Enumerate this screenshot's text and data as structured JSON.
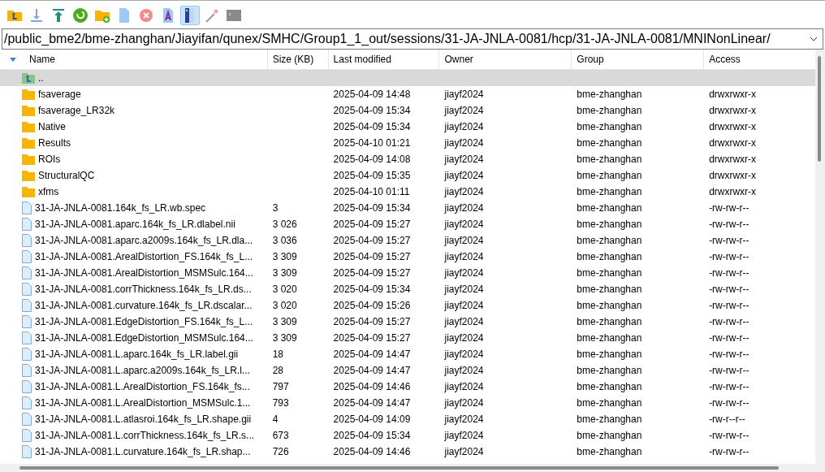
{
  "toolbar": [
    {
      "kind": "parent-folder",
      "on": false
    },
    {
      "kind": "download",
      "on": false
    },
    {
      "kind": "upload",
      "on": false
    },
    {
      "kind": "refresh",
      "on": false
    },
    {
      "kind": "new-folder",
      "on": false
    },
    {
      "kind": "new-file",
      "on": false
    },
    {
      "kind": "delete",
      "on": false
    },
    {
      "kind": "rename",
      "on": false
    },
    {
      "kind": "panel",
      "on": true
    },
    {
      "kind": "wand",
      "on": false
    },
    {
      "kind": "terminal",
      "on": false
    }
  ],
  "path": {
    "value": "/public_bme2/bme-zhanghan/Jiayifan/qunex/SMHC/Group1_1_out/sessions/31-JA-JNLA-0081/hcp/31-JA-JNLA-0081/MNINonLinear/"
  },
  "table": {
    "columns": [
      {
        "label": "Name",
        "sorted": true
      },
      {
        "label": "Size (KB)",
        "sorted": false
      },
      {
        "label": "Last modified",
        "sorted": false
      },
      {
        "label": "Owner",
        "sorted": false
      },
      {
        "label": "Group",
        "sorted": false
      },
      {
        "label": "Access",
        "sorted": false
      }
    ],
    "rows": [
      {
        "kind": "parent",
        "name": "..",
        "selected": true
      },
      {
        "kind": "folder",
        "name": "fsaverage",
        "modified": "2025-04-09 14:48",
        "owner": "jiayf2024",
        "group": "bme-zhanghan",
        "access": "drwxrwxr-x",
        "selected": false
      },
      {
        "kind": "folder",
        "name": "fsaverage_LR32k",
        "modified": "2025-04-09 15:34",
        "owner": "jiayf2024",
        "group": "bme-zhanghan",
        "access": "drwxrwxr-x",
        "selected": false
      },
      {
        "kind": "folder",
        "name": "Native",
        "modified": "2025-04-09 15:34",
        "owner": "jiayf2024",
        "group": "bme-zhanghan",
        "access": "drwxrwxr-x",
        "selected": false
      },
      {
        "kind": "folder",
        "name": "Results",
        "modified": "2025-04-10 01:21",
        "owner": "jiayf2024",
        "group": "bme-zhanghan",
        "access": "drwxrwxr-x",
        "selected": false
      },
      {
        "kind": "folder",
        "name": "ROIs",
        "modified": "2025-04-09 14:08",
        "owner": "jiayf2024",
        "group": "bme-zhanghan",
        "access": "drwxrwxr-x",
        "selected": false
      },
      {
        "kind": "folder",
        "name": "StructuralQC",
        "modified": "2025-04-09 15:35",
        "owner": "jiayf2024",
        "group": "bme-zhanghan",
        "access": "drwxrwxr-x",
        "selected": false
      },
      {
        "kind": "folder",
        "name": "xfms",
        "modified": "2025-04-10 01:11",
        "owner": "jiayf2024",
        "group": "bme-zhanghan",
        "access": "drwxrwxr-x",
        "selected": false
      },
      {
        "kind": "file",
        "name": "31-JA-JNLA-0081.164k_fs_LR.wb.spec",
        "size": "3",
        "modified": "2025-04-09 15:34",
        "owner": "jiayf2024",
        "group": "bme-zhanghan",
        "access": "-rw-rw-r--",
        "selected": false
      },
      {
        "kind": "file",
        "name": "31-JA-JNLA-0081.aparc.164k_fs_LR.dlabel.nii",
        "size": "3 026",
        "modified": "2025-04-09 15:27",
        "owner": "jiayf2024",
        "group": "bme-zhanghan",
        "access": "-rw-rw-r--",
        "selected": false
      },
      {
        "kind": "file",
        "name": "31-JA-JNLA-0081.aparc.a2009s.164k_fs_LR.dla...",
        "size": "3 036",
        "modified": "2025-04-09 15:27",
        "owner": "jiayf2024",
        "group": "bme-zhanghan",
        "access": "-rw-rw-r--",
        "selected": false
      },
      {
        "kind": "file",
        "name": "31-JA-JNLA-0081.ArealDistortion_FS.164k_fs_L...",
        "size": "3 309",
        "modified": "2025-04-09 15:27",
        "owner": "jiayf2024",
        "group": "bme-zhanghan",
        "access": "-rw-rw-r--",
        "selected": false
      },
      {
        "kind": "file",
        "name": "31-JA-JNLA-0081.ArealDistortion_MSMSulc.164...",
        "size": "3 309",
        "modified": "2025-04-09 15:27",
        "owner": "jiayf2024",
        "group": "bme-zhanghan",
        "access": "-rw-rw-r--",
        "selected": false
      },
      {
        "kind": "file",
        "name": "31-JA-JNLA-0081.corrThickness.164k_fs_LR.ds...",
        "size": "3 020",
        "modified": "2025-04-09 15:34",
        "owner": "jiayf2024",
        "group": "bme-zhanghan",
        "access": "-rw-rw-r--",
        "selected": false
      },
      {
        "kind": "file",
        "name": "31-JA-JNLA-0081.curvature.164k_fs_LR.dscalar...",
        "size": "3 020",
        "modified": "2025-04-09 15:26",
        "owner": "jiayf2024",
        "group": "bme-zhanghan",
        "access": "-rw-rw-r--",
        "selected": false
      },
      {
        "kind": "file",
        "name": "31-JA-JNLA-0081.EdgeDistortion_FS.164k_fs_L...",
        "size": "3 309",
        "modified": "2025-04-09 15:27",
        "owner": "jiayf2024",
        "group": "bme-zhanghan",
        "access": "-rw-rw-r--",
        "selected": false
      },
      {
        "kind": "file",
        "name": "31-JA-JNLA-0081.EdgeDistortion_MSMSulc.164...",
        "size": "3 309",
        "modified": "2025-04-09 15:27",
        "owner": "jiayf2024",
        "group": "bme-zhanghan",
        "access": "-rw-rw-r--",
        "selected": false
      },
      {
        "kind": "file",
        "name": "31-JA-JNLA-0081.L.aparc.164k_fs_LR.label.gii",
        "size": "18",
        "modified": "2025-04-09 14:47",
        "owner": "jiayf2024",
        "group": "bme-zhanghan",
        "access": "-rw-rw-r--",
        "selected": false
      },
      {
        "kind": "file",
        "name": "31-JA-JNLA-0081.L.aparc.a2009s.164k_fs_LR.l...",
        "size": "28",
        "modified": "2025-04-09 14:47",
        "owner": "jiayf2024",
        "group": "bme-zhanghan",
        "access": "-rw-rw-r--",
        "selected": false
      },
      {
        "kind": "file",
        "name": "31-JA-JNLA-0081.L.ArealDistortion_FS.164k_fs...",
        "size": "797",
        "modified": "2025-04-09 14:46",
        "owner": "jiayf2024",
        "group": "bme-zhanghan",
        "access": "-rw-rw-r--",
        "selected": false
      },
      {
        "kind": "file",
        "name": "31-JA-JNLA-0081.L.ArealDistortion_MSMSulc.1...",
        "size": "793",
        "modified": "2025-04-09 14:47",
        "owner": "jiayf2024",
        "group": "bme-zhanghan",
        "access": "-rw-rw-r--",
        "selected": false
      },
      {
        "kind": "file",
        "name": "31-JA-JNLA-0081.L.atlasroi.164k_fs_LR.shape.gii",
        "size": "4",
        "modified": "2025-04-09 14:09",
        "owner": "jiayf2024",
        "group": "bme-zhanghan",
        "access": "-rw-r--r--",
        "selected": false
      },
      {
        "kind": "file",
        "name": "31-JA-JNLA-0081.L.corrThickness.164k_fs_LR.s...",
        "size": "673",
        "modified": "2025-04-09 15:34",
        "owner": "jiayf2024",
        "group": "bme-zhanghan",
        "access": "-rw-rw-r--",
        "selected": false
      },
      {
        "kind": "file",
        "name": "31-JA-JNLA-0081.L.curvature.164k_fs_LR.shap...",
        "size": "726",
        "modified": "2025-04-09 14:46",
        "owner": "jiayf2024",
        "group": "bme-zhanghan",
        "access": "-rw-rw-r--",
        "selected": false
      }
    ]
  }
}
